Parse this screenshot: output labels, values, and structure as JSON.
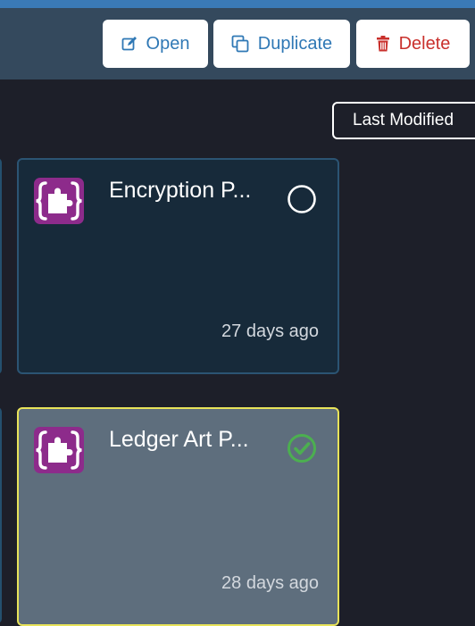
{
  "toolbar": {
    "open_label": "Open",
    "duplicate_label": "Duplicate",
    "delete_label": "Delete",
    "open_icon": "edit-icon",
    "duplicate_icon": "copy-icon",
    "delete_icon": "trash-icon"
  },
  "sort": {
    "label": "Last Modified"
  },
  "cards": [
    {
      "title": "Encryption P...",
      "modified": "27 days ago",
      "icon": "plugin-icon",
      "status": "unselected",
      "status_icon": "empty-circle-icon"
    },
    {
      "title": "Ledger Art P...",
      "modified": "28 days ago",
      "icon": "plugin-icon",
      "status": "selected",
      "status_icon": "check-circle-icon"
    }
  ],
  "colors": {
    "accent_blue": "#2f78b5",
    "danger_red": "#c9302c",
    "selected_border": "#e8e35a",
    "check_green": "#4caf50",
    "plugin_purple": "#8d2b8b"
  }
}
